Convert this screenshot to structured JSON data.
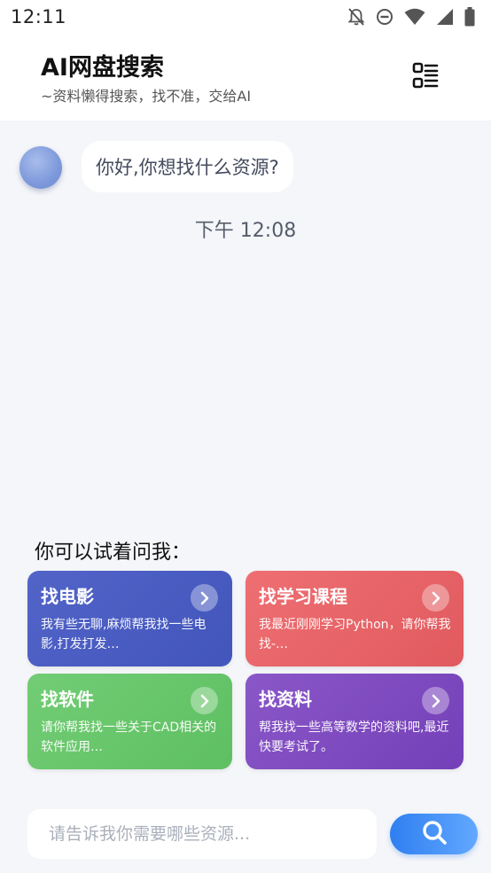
{
  "status_bar": {
    "time": "12:11",
    "icons": [
      "notifications-off-icon",
      "do-not-disturb-icon",
      "wifi-icon",
      "signal-icon",
      "battery-icon"
    ]
  },
  "header": {
    "title": "AI网盘搜索",
    "subtitle": "~资料懒得搜索，找不准，交给AI",
    "menu_icon": "list-menu-icon"
  },
  "chat": {
    "messages": [
      {
        "sender": "bot",
        "text": "你好,你想找什么资源?"
      }
    ],
    "timestamp": "下午 12:08"
  },
  "suggestions": {
    "title": "你可以试着问我：",
    "cards": [
      {
        "title": "找电影",
        "desc": "我有些无聊,麻烦帮我找一些电影,打发打发…",
        "color": "#4a5cc2"
      },
      {
        "title": "找学习课程",
        "desc": "我最近刚刚学习Python，请你帮我找-…",
        "color": "#e8666a"
      },
      {
        "title": "找软件",
        "desc": "请你帮我找一些关于CAD相关的软件应用…",
        "color": "#68c76b"
      },
      {
        "title": "找资料",
        "desc": "帮我找一些高等数学的资料吧,最近快要考试了。",
        "color": "#7f4cc0"
      }
    ]
  },
  "search": {
    "placeholder": "请告诉我你需要哪些资源...",
    "value": "",
    "button_icon": "search-icon",
    "accent": "#2f7ff0"
  }
}
